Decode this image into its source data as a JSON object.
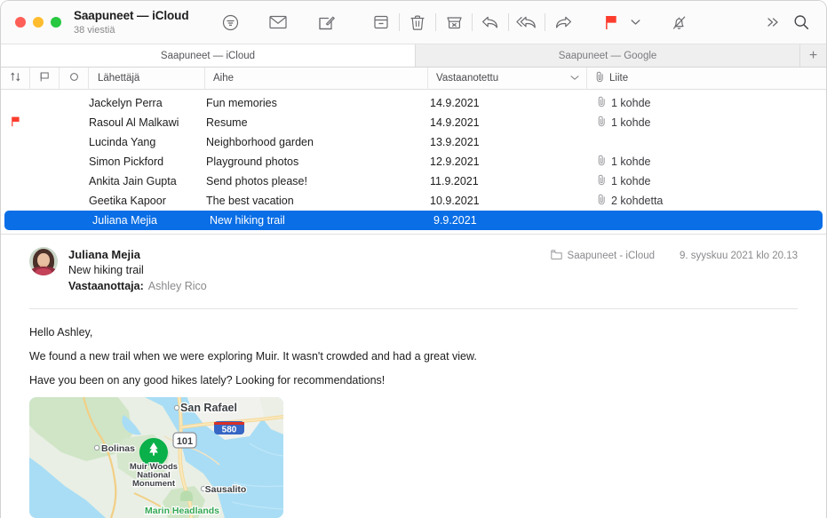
{
  "window": {
    "title": "Saapuneet — iCloud",
    "subtitle": "38 viestiä"
  },
  "toolbar": {
    "items": [
      {
        "name": "filter-icon",
        "label": "Suodata"
      },
      {
        "name": "mail-icon",
        "label": "Hae posti"
      },
      {
        "name": "compose-icon",
        "label": "Uusi viesti"
      },
      {
        "name": "archive-icon",
        "label": "Arkistoi"
      },
      {
        "name": "trash-icon",
        "label": "Poista"
      },
      {
        "name": "junk-icon",
        "label": "Roskaposti"
      },
      {
        "name": "reply-icon",
        "label": "Vastaa"
      },
      {
        "name": "reply-all-icon",
        "label": "Vastaa kaikille"
      },
      {
        "name": "forward-icon",
        "label": "Välitä"
      },
      {
        "name": "flag-icon",
        "label": "Lippu"
      },
      {
        "name": "chevron-down-icon",
        "label": "Lippuvalikko"
      },
      {
        "name": "mute-bell-icon",
        "label": "Mykistä"
      },
      {
        "name": "overflow-icon",
        "label": "Lisää"
      },
      {
        "name": "search-icon",
        "label": "Etsi"
      }
    ],
    "flag_color": "#fc3d2e"
  },
  "tabs": {
    "active": "Saapuneet — iCloud",
    "inactive": "Saapuneet — Google",
    "add_label": "+"
  },
  "columns": {
    "sort_icon": "sort-icon",
    "flag_icon": "flag-column-icon",
    "unread_icon": "unread-dot-icon",
    "sender": "Lähettäjä",
    "subject": "Aihe",
    "received": "Vastaanotettu",
    "attachment": "Liite",
    "sort_chevron": "chevron-down-icon",
    "attachment_icon": "paperclip-icon"
  },
  "messages": [
    {
      "flagged": false,
      "sender": "Jackelyn Perra",
      "subject": "Fun memories",
      "date": "14.9.2021",
      "attachment": "1 kohde",
      "selected": false
    },
    {
      "flagged": true,
      "sender": "Rasoul Al Malkawi",
      "subject": "Resume",
      "date": "14.9.2021",
      "attachment": "1 kohde",
      "selected": false
    },
    {
      "flagged": false,
      "sender": "Lucinda Yang",
      "subject": "Neighborhood garden",
      "date": "13.9.2021",
      "attachment": "",
      "selected": false
    },
    {
      "flagged": false,
      "sender": "Simon Pickford",
      "subject": "Playground photos",
      "date": "12.9.2021",
      "attachment": "1 kohde",
      "selected": false
    },
    {
      "flagged": false,
      "sender": "Ankita Jain Gupta",
      "subject": "Send photos please!",
      "date": "11.9.2021",
      "attachment": "1 kohde",
      "selected": false
    },
    {
      "flagged": false,
      "sender": "Geetika Kapoor",
      "subject": "The best vacation",
      "date": "10.9.2021",
      "attachment": "2 kohdetta",
      "selected": false
    },
    {
      "flagged": false,
      "sender": "Juliana Mejia",
      "subject": "New hiking trail",
      "date": "9.9.2021",
      "attachment": "",
      "selected": true
    }
  ],
  "selection_color": "#0a6ee6",
  "message": {
    "from": "Juliana Mejia",
    "subject": "New hiking trail",
    "to_label": "Vastaanottaja:",
    "to_value": "Ashley Rico",
    "mailbox": "Saapuneet - iCloud",
    "timestamp": "9. syyskuu 2021 klo 20.13",
    "body": [
      "Hello Ashley,",
      "We found a new trail when we were exploring Muir. It wasn't crowded and had a great view.",
      "Have you been on any good hikes lately? Looking for recommendations!"
    ]
  },
  "map": {
    "labels": {
      "san_rafael": "San Rafael",
      "bolinas": "Bolinas",
      "sausalito": "Sausalito",
      "muir_woods": [
        "Muir Woods",
        "National",
        "Monument"
      ],
      "marin_headlands": "Marin Headlands",
      "route_101": "101",
      "route_580": "580"
    },
    "pin_color": "#0ab04a",
    "water_color": "#a5dcf5"
  }
}
